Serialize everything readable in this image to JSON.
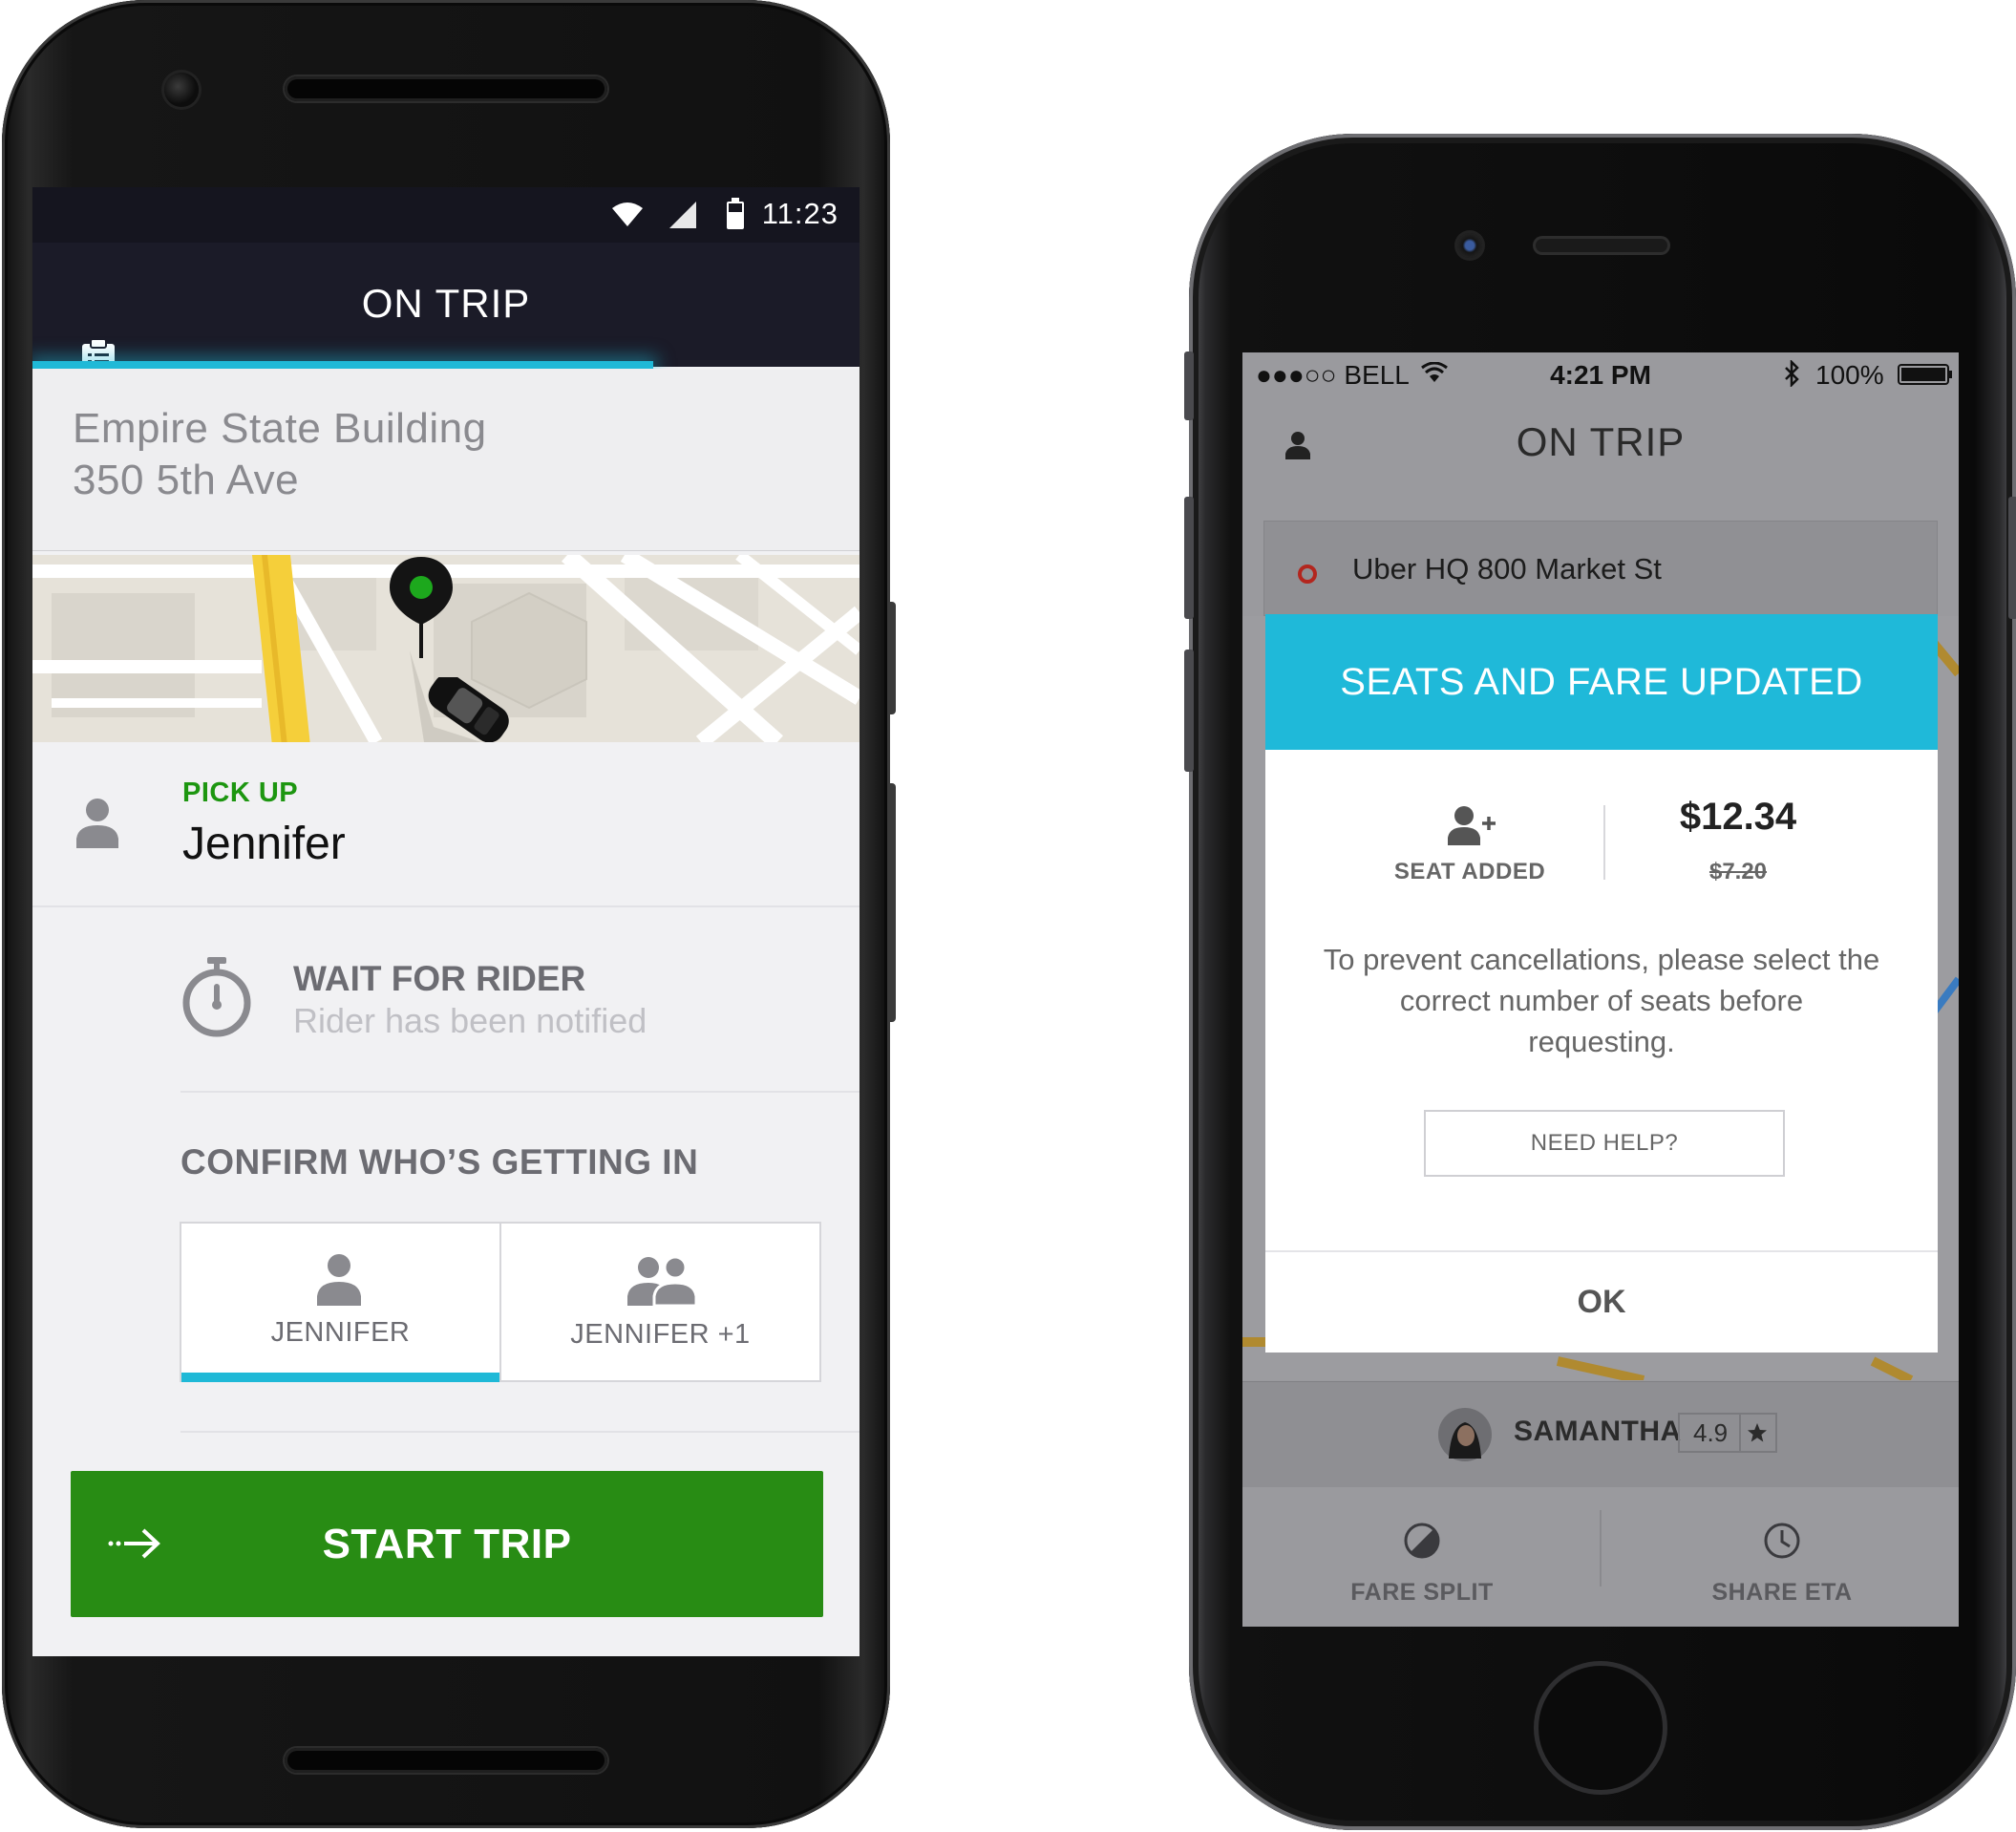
{
  "android": {
    "status_time": "11:23",
    "header_title": "ON TRIP",
    "destination": {
      "line1": "Empire State Building",
      "line2": "350 5th Ave"
    },
    "pickup": {
      "label": "PICK UP",
      "name": "Jennifer"
    },
    "wait": {
      "title": "WAIT FOR RIDER",
      "subtitle": "Rider has been notified"
    },
    "confirm_heading": "CONFIRM WHO’S GETTING IN",
    "options": [
      {
        "label": "JENNIFER",
        "selected": true
      },
      {
        "label": "JENNIFER +1",
        "selected": false
      }
    ],
    "start_button": "START TRIP",
    "progress": 0.75
  },
  "ios": {
    "status": {
      "carrier": "●●●○○ BELL",
      "time": "4:21 PM",
      "battery": "100%"
    },
    "nav_title": "ON TRIP",
    "destination": "Uber HQ 800 Market St",
    "modal": {
      "title": "SEATS AND FARE UPDATED",
      "seat_label": "SEAT ADDED",
      "new_price": "$12.34",
      "old_price": "$7.20",
      "message": "To prevent cancellations, please select the correct number of seats before requesting.",
      "help_button": "NEED HELP?",
      "ok_button": "OK"
    },
    "driver": {
      "name": "SAMANTHA",
      "rating": "4.9"
    },
    "bottom_actions": [
      {
        "label": "FARE SPLIT"
      },
      {
        "label": "SHARE ETA"
      }
    ]
  },
  "colors": {
    "accent_cyan": "#1fb9d7",
    "start_green": "#288c14",
    "pickup_green": "#1d9610",
    "header_dark": "#1b1b28"
  }
}
